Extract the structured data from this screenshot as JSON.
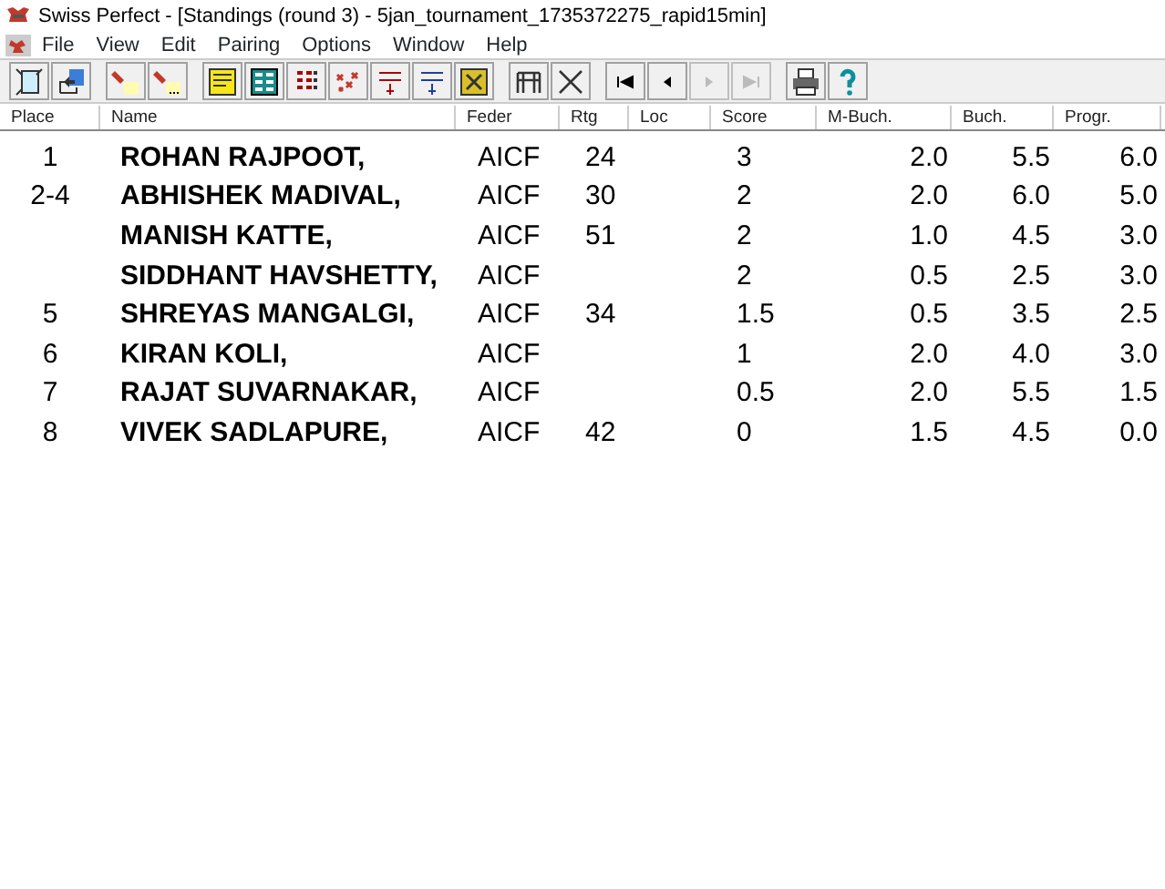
{
  "window": {
    "title": "Swiss Perfect - [Standings  (round 3) - 5jan_tournament_1735372275_rapid15min]"
  },
  "menu": [
    "File",
    "View",
    "Edit",
    "Pairing",
    "Options",
    "Window",
    "Help"
  ],
  "toolbar": [
    {
      "buttons": [
        {
          "disabled": false
        },
        {
          "disabled": false
        }
      ]
    },
    {
      "buttons": [
        {
          "disabled": false
        },
        {
          "disabled": false
        }
      ]
    },
    {
      "buttons": [
        {
          "disabled": false
        },
        {
          "disabled": false
        },
        {
          "disabled": false
        },
        {
          "disabled": false
        },
        {
          "disabled": false
        },
        {
          "disabled": false
        },
        {
          "disabled": false
        }
      ]
    },
    {
      "buttons": [
        {
          "disabled": false
        },
        {
          "disabled": false
        }
      ]
    },
    {
      "buttons": [
        {
          "disabled": false
        },
        {
          "disabled": false
        },
        {
          "disabled": true
        },
        {
          "disabled": true
        }
      ]
    },
    {
      "buttons": [
        {
          "disabled": false
        },
        {
          "disabled": false
        }
      ]
    }
  ],
  "table": {
    "columns": [
      "Place",
      "Name",
      "Feder",
      "Rtg",
      "Loc",
      "Score",
      "M-Buch.",
      "Buch.",
      "Progr."
    ],
    "rows": [
      {
        "place": "1",
        "name": "ROHAN RAJPOOT,",
        "feder": "AICF",
        "rtg": "24",
        "score": "3",
        "m_buch": "2.0",
        "buch": "5.5",
        "progr": "6.0"
      },
      {
        "place": "2-4",
        "name": "ABHISHEK MADIVAL,",
        "feder": "AICF",
        "rtg": "30",
        "score": "2",
        "m_buch": "2.0",
        "buch": "6.0",
        "progr": "5.0"
      },
      {
        "name": "MANISH KATTE,",
        "feder": "AICF",
        "rtg": "51",
        "score": "2",
        "m_buch": "1.0",
        "buch": "4.5",
        "progr": "3.0"
      },
      {
        "name": "SIDDHANT HAVSHETTY,",
        "feder": "AICF",
        "score": "2",
        "m_buch": "0.5",
        "buch": "2.5",
        "progr": "3.0"
      },
      {
        "place": "5",
        "name": "SHREYAS MANGALGI,",
        "feder": "AICF",
        "rtg": "34",
        "score": "1.5",
        "m_buch": "0.5",
        "buch": "3.5",
        "progr": "2.5"
      },
      {
        "place": "6",
        "name": "KIRAN KOLI,",
        "feder": "AICF",
        "score": "1",
        "m_buch": "2.0",
        "buch": "4.0",
        "progr": "3.0"
      },
      {
        "place": "7",
        "name": "RAJAT SUVARNAKAR,",
        "feder": "AICF",
        "score": "0.5",
        "m_buch": "2.0",
        "buch": "5.5",
        "progr": "1.5"
      },
      {
        "place": "8",
        "name": "VIVEK SADLAPURE,",
        "feder": "AICF",
        "rtg": "42",
        "score": "0",
        "m_buch": "1.5",
        "buch": "4.5",
        "progr": "0.0"
      }
    ]
  }
}
